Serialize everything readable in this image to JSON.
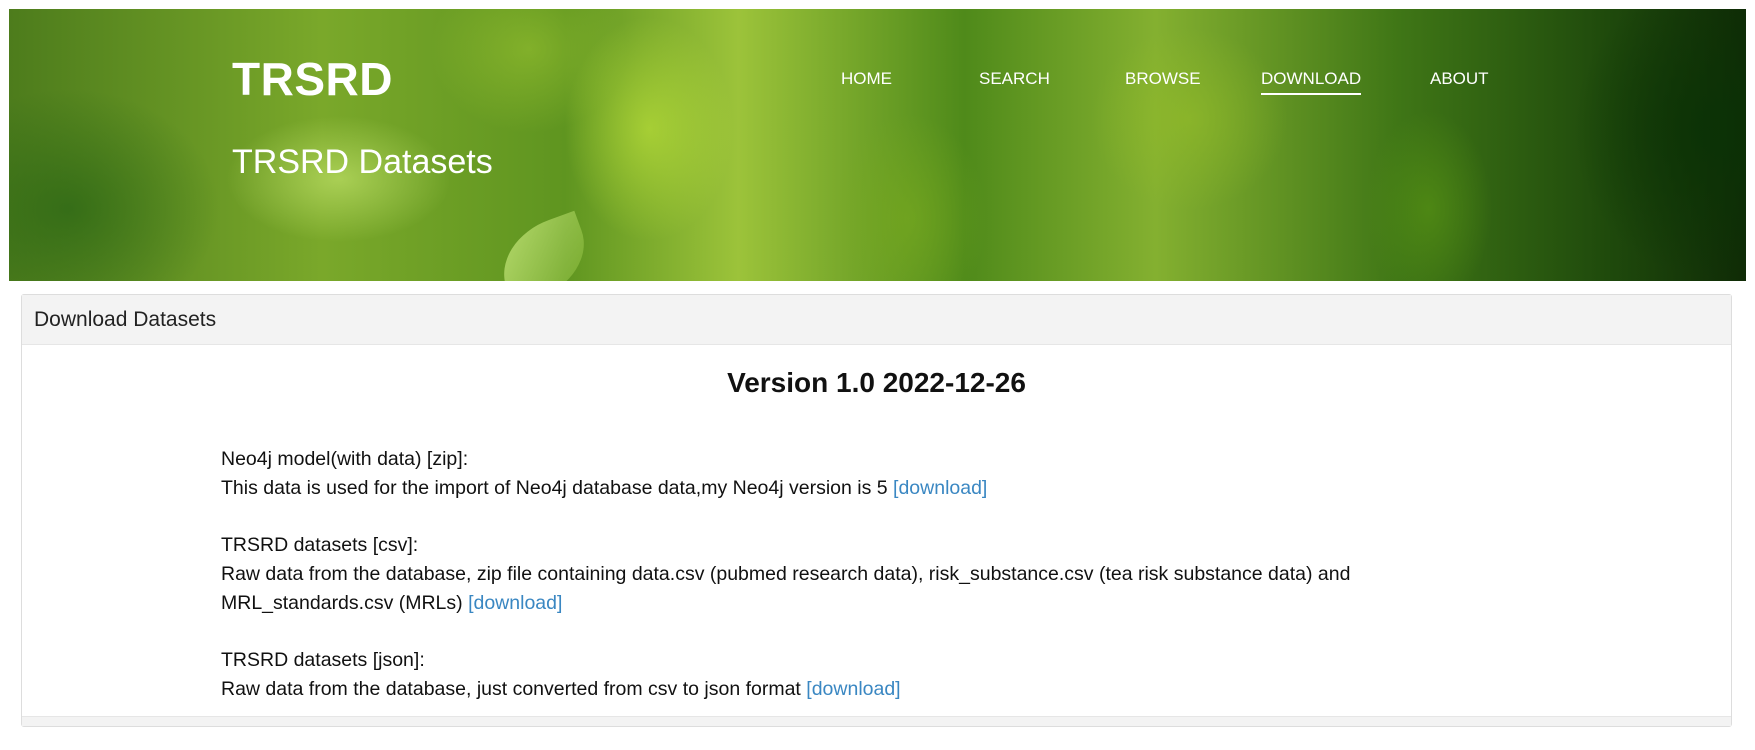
{
  "header": {
    "site_title": "TRSRD",
    "page_heading": "TRSRD Datasets",
    "nav": {
      "home": "HOME",
      "search": "SEARCH",
      "browse": "BROWSE",
      "download": "DOWNLOAD",
      "about": "ABOUT",
      "active": "DOWNLOAD"
    }
  },
  "panel": {
    "heading": "Download Datasets",
    "version": "Version 1.0 2022-12-26",
    "entries": [
      {
        "title": "Neo4j model(with data) [zip]:",
        "description": "This data is used for the import of Neo4j database data,my Neo4j version is 5",
        "link_label": "[download]"
      },
      {
        "title": "TRSRD datasets [csv]:",
        "description": "Raw data from the database, zip file containing data.csv (pubmed research data), risk_substance.csv (tea risk substance data) and MRL_standards.csv (MRLs)",
        "link_label": "[download]"
      },
      {
        "title": "TRSRD datasets [json]:",
        "description": "Raw data from the database, just converted from csv to json format",
        "link_label": "[download]"
      }
    ]
  },
  "colors": {
    "link": "#3a87c2",
    "panel_heading_bg": "#f3f3f3",
    "header_text": "#ffffff"
  }
}
